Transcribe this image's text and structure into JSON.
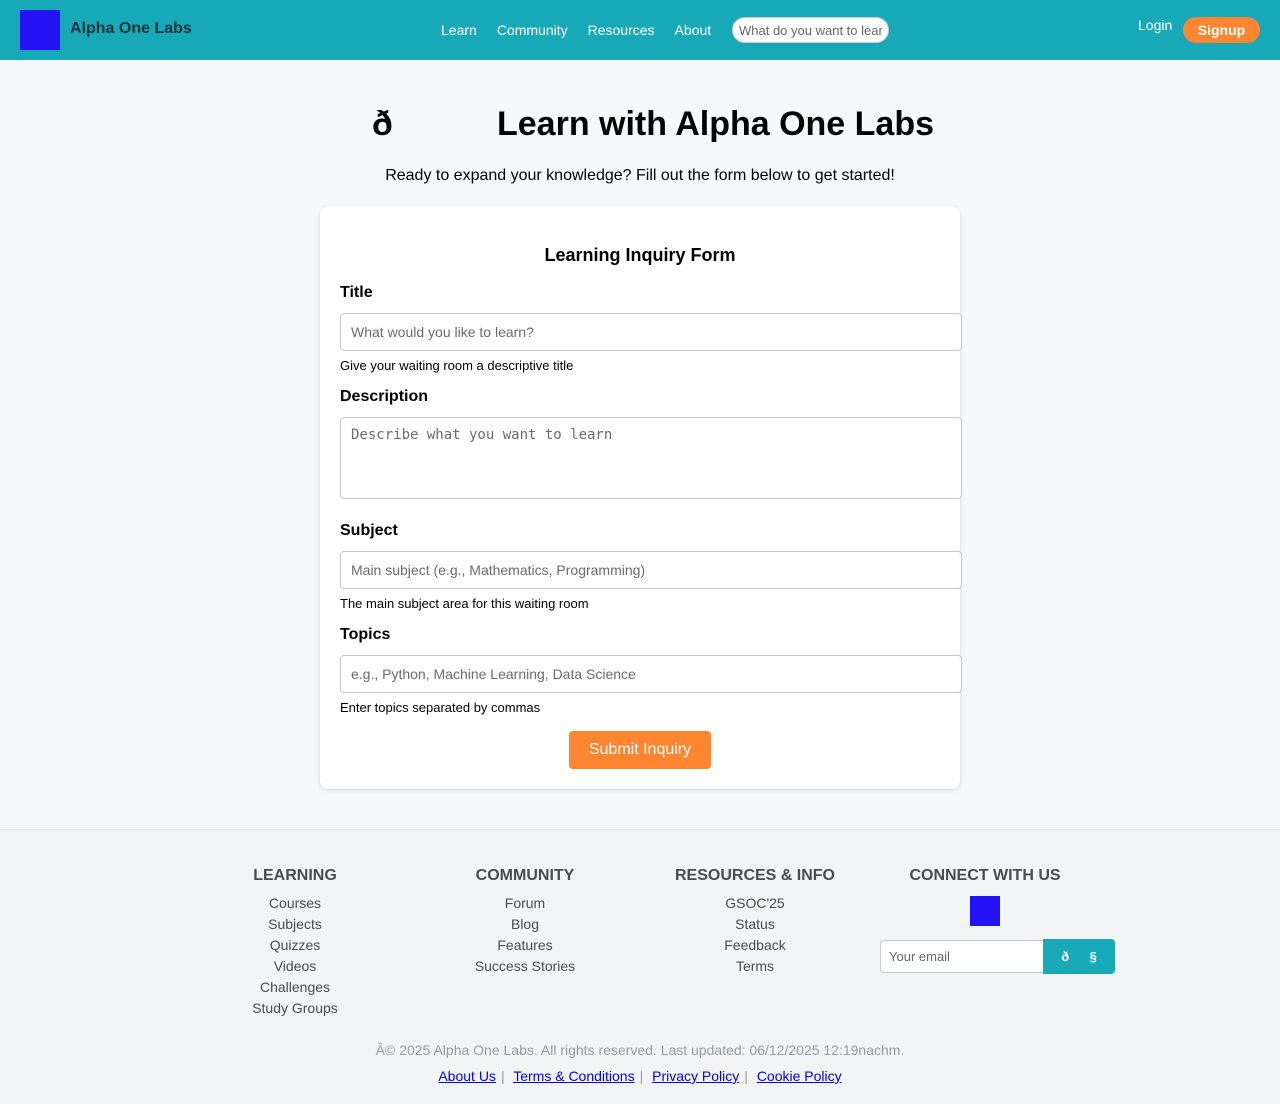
{
  "header": {
    "brand": "Alpha One Labs",
    "nav": [
      "Learn",
      "Community",
      "Resources",
      "About"
    ],
    "search_placeholder": "What do you want to learn?",
    "login": "Login",
    "signup": "Signup"
  },
  "hero": {
    "emoji": "ð",
    "title": "Learn with Alpha One Labs",
    "subtitle": "Ready to expand your knowledge? Fill out the form below to get started!"
  },
  "form": {
    "title": "Learning Inquiry Form",
    "title_label": "Title",
    "title_placeholder": "What would you like to learn?",
    "title_help": "Give your waiting room a descriptive title",
    "description_label": "Description",
    "description_placeholder": "Describe what you want to learn",
    "subject_label": "Subject",
    "subject_placeholder": "Main subject (e.g., Mathematics, Programming)",
    "subject_help": "The main subject area for this waiting room",
    "topics_label": "Topics",
    "topics_placeholder": "e.g., Python, Machine Learning, Data Science",
    "topics_help": "Enter topics separated by commas",
    "submit": "Submit Inquiry"
  },
  "footer": {
    "learning": {
      "heading": "LEARNING",
      "items": [
        "Courses",
        "Subjects",
        "Quizzes",
        "Videos",
        "Challenges",
        "Study Groups"
      ]
    },
    "community": {
      "heading": "COMMUNITY",
      "items": [
        "Forum",
        "Blog",
        "Features",
        "Success Stories"
      ]
    },
    "resources": {
      "heading": "RESOURCES & INFO",
      "items": [
        "GSOC'25",
        "Status",
        "Feedback",
        "Terms"
      ]
    },
    "connect": {
      "heading": "CONNECT WITH US",
      "email_placeholder": "Your email",
      "button_glyphs": [
        "ð",
        "§"
      ]
    },
    "copyright": "Â© 2025 Alpha One Labs. All rights reserved. Last updated: 06/12/2025 12:19nachm.",
    "legal": [
      "About Us",
      "Terms & Conditions",
      "Privacy Policy",
      "Cookie Policy"
    ],
    "separator": "|"
  },
  "colors": {
    "nav_bg": "#18a9b8",
    "accent_orange": "#ff8630",
    "logo_blue": "#2212f5"
  }
}
